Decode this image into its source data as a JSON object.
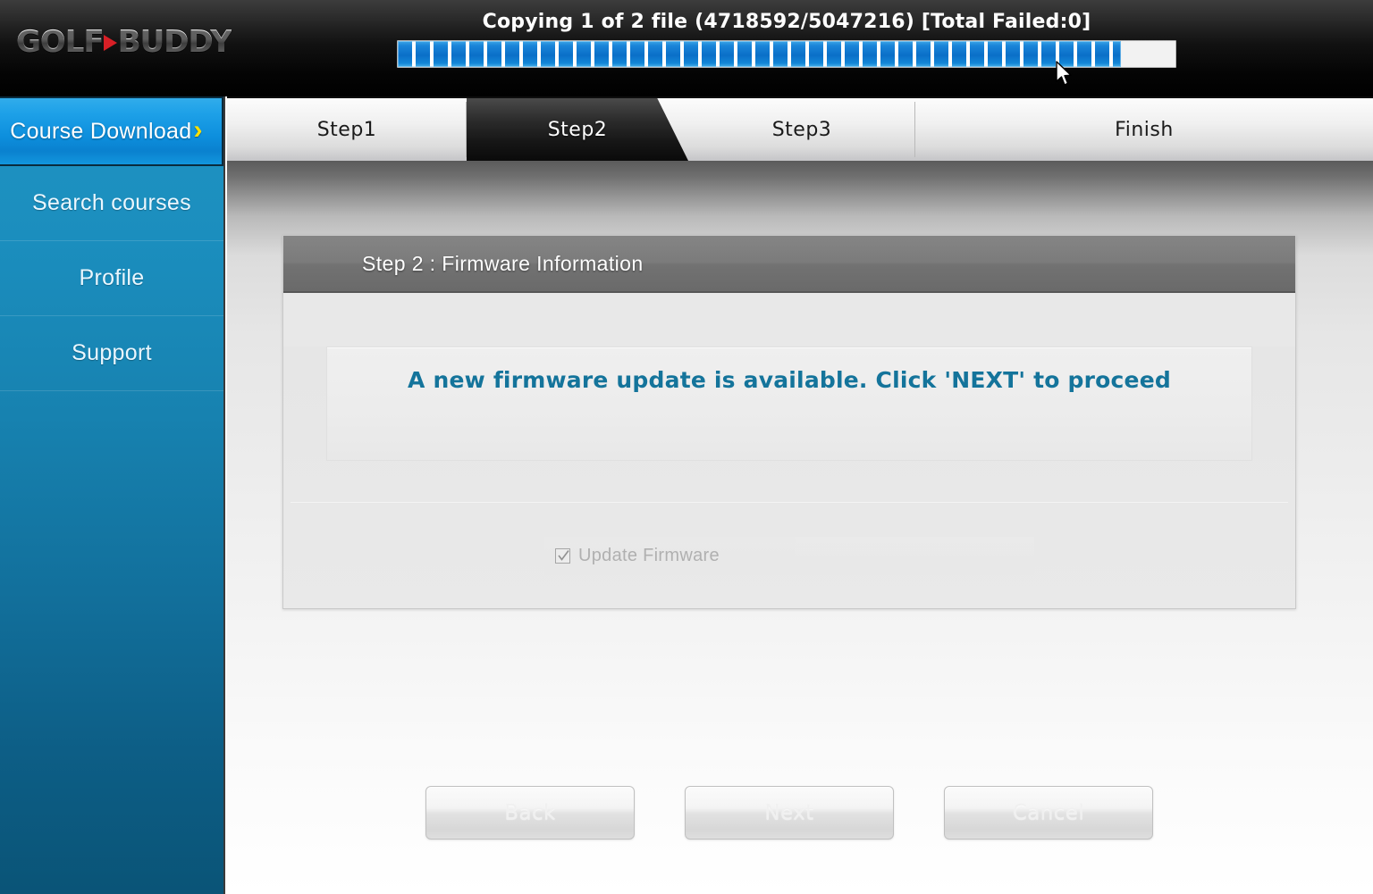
{
  "app": {
    "brand_primary": "GOLF",
    "brand_secondary": "BUDDY",
    "accent_red": "#d81f26",
    "accent_blue": "#0d8fdd",
    "accent_yellow": "#ffe100"
  },
  "transfer": {
    "status_text": "Copying 1 of 2 file (4718592/5047216) [Total Failed:0]",
    "files_current": 1,
    "files_total": 2,
    "bytes_done": 4718592,
    "bytes_total": 5047216,
    "total_failed": 0,
    "percent": 93
  },
  "sidebar": {
    "items": [
      {
        "label": "Course Download",
        "active": true,
        "chevron": "›"
      },
      {
        "label": "Search courses",
        "active": false
      },
      {
        "label": "Profile",
        "active": false
      },
      {
        "label": "Support",
        "active": false
      }
    ]
  },
  "tabs": [
    {
      "label": "Step1",
      "active": false
    },
    {
      "label": "Step2",
      "active": true
    },
    {
      "label": "Step3",
      "active": false
    },
    {
      "label": "Finish",
      "active": false
    }
  ],
  "panel": {
    "header_title": "Step 2 : Firmware Information",
    "message": "A new firmware update is available. Click 'NEXT' to proceed",
    "message_color": "#14749b",
    "checkbox": {
      "label": "Update Firmware",
      "checked": true,
      "disabled": true
    }
  },
  "buttons": [
    {
      "label": "Back",
      "disabled": true
    },
    {
      "label": "Next",
      "disabled": true
    },
    {
      "label": "Cancel",
      "disabled": true
    }
  ]
}
